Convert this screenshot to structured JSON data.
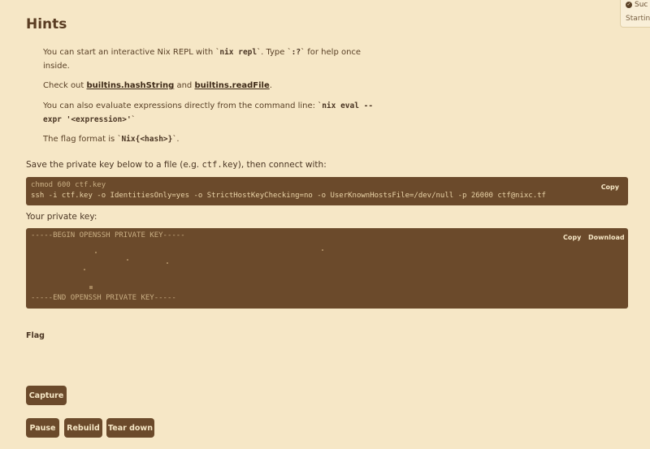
{
  "toast": {
    "title": "Suc",
    "subtitle": "Startin"
  },
  "hints": {
    "title": "Hints",
    "h1_pre": "You can start an interactive Nix REPL with `",
    "h1_code1": "nix repl",
    "h1_mid": "`. Type `",
    "h1_code2": ":?",
    "h1_post1": "` for help once",
    "h1_post2": "inside.",
    "h2_pre": "Check out ",
    "h2_link1": "builtins.hashString",
    "h2_mid": " and ",
    "h2_link2": "builtins.readFile",
    "h2_post": ".",
    "h3_pre": "You can also evaluate expressions directly from the command line: `",
    "h3_code1": "nix eval --",
    "h3_code2": "expr '<expression>'",
    "h3_post": "`",
    "h4_pre": "The flag format is `",
    "h4_code": "Nix{<hash>}",
    "h4_post": "`."
  },
  "connect": {
    "label_pre": "Save the private key below to a file (e.g. ",
    "label_code": "ctf.key",
    "label_post": "), then connect with:",
    "line1": "chmod 600 ctf.key",
    "line2": "ssh -i ctf.key -o IdentitiesOnly=yes -o StrictHostKeyChecking=no -o UserKnownHostsFile=/dev/null -p 26000 ctf@nixc.tf",
    "copy_label": "Copy"
  },
  "private_key": {
    "label": "Your private key:",
    "begin": "-----BEGIN OPENSSH PRIVATE KEY-----",
    "end": "-----END OPENSSH PRIVATE KEY-----",
    "copy_label": "Copy",
    "download_label": "Download"
  },
  "flag": {
    "label": "Flag"
  },
  "buttons": {
    "capture": "Capture",
    "pause": "Pause",
    "rebuild": "Rebuild",
    "teardown": "Tear down"
  }
}
